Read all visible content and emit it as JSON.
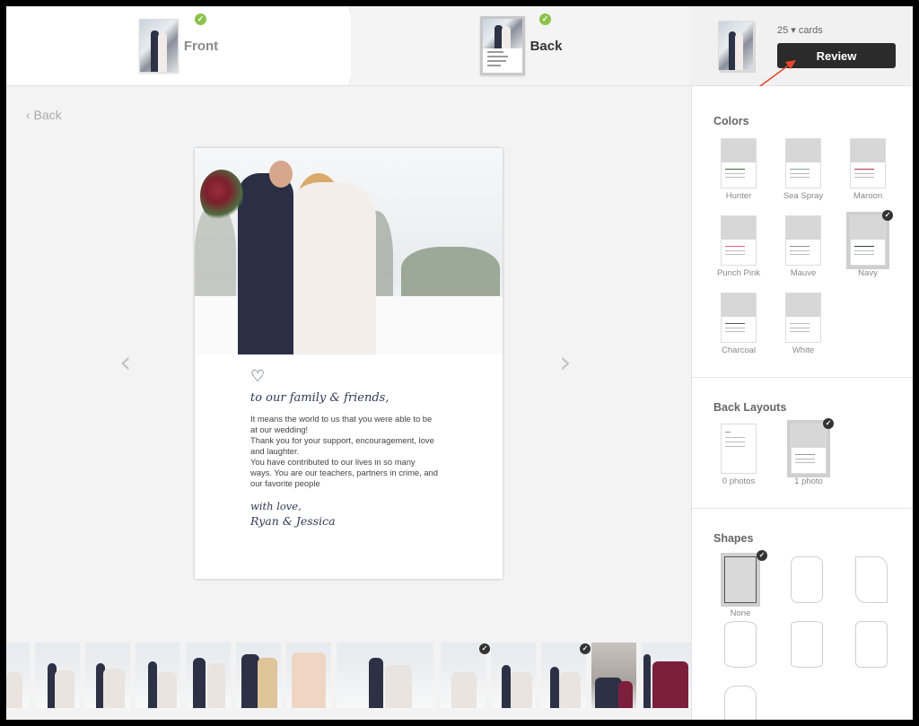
{
  "steps": {
    "front_label": "Front",
    "back_label": "Back",
    "check_glyph": "✓"
  },
  "header": {
    "cards_count": "25 ▾ cards",
    "review_label": "Review"
  },
  "main": {
    "back_link": "‹  Back",
    "prev_arrow": "‹",
    "next_arrow": "›"
  },
  "card": {
    "heart": "♡",
    "greeting": "to our family & friends,",
    "lines": [
      "It means the world to us that you were able to be",
      "at our wedding!",
      "Thank you for your support, encouragement, love",
      "and laughter.",
      "You have contributed to our lives in so many",
      "ways. You are our teachers, partners in crime, and",
      "our favorite people"
    ],
    "closing": "with love,",
    "names": "Ryan & Jessica"
  },
  "panel": {
    "colors_title": "Colors",
    "colors": [
      {
        "name": "Hunter",
        "accent": "#3f5e3a"
      },
      {
        "name": "Sea Spray",
        "accent": "#7fa7a0"
      },
      {
        "name": "Maroon",
        "accent": "#b23a4a"
      },
      {
        "name": "Punch Pink",
        "accent": "#e46a7e"
      },
      {
        "name": "Mauve",
        "accent": "#a58a97"
      },
      {
        "name": "Navy",
        "accent": "#2e3a55",
        "selected": true
      },
      {
        "name": "Charcoal",
        "accent": "#555555"
      },
      {
        "name": "White",
        "accent": "#bbbbbb"
      }
    ],
    "layouts_title": "Back Layouts",
    "layouts": [
      {
        "name": "0 photos"
      },
      {
        "name": "1 photo",
        "selected": true
      }
    ],
    "shapes_title": "Shapes",
    "shapes": [
      {
        "name": "None",
        "selected": true
      }
    ]
  },
  "filmstrip": {
    "photo_count": 14
  },
  "colors": {
    "accent_check": "#8bc34a",
    "dark": "#2b2b2b",
    "annotation": "#e8472b"
  }
}
